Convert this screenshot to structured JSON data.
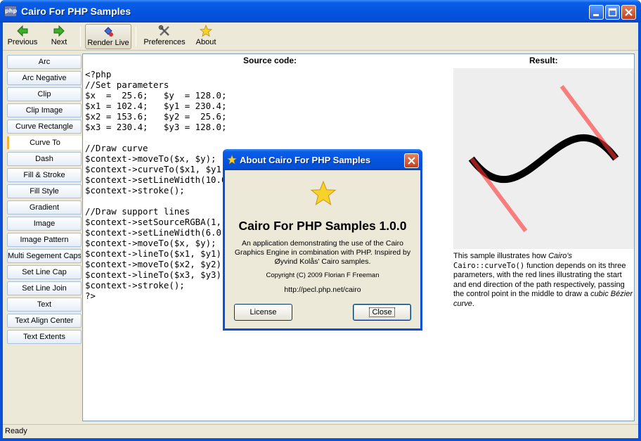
{
  "window": {
    "title": "Cairo For PHP Samples",
    "icon_text": "php",
    "controls": {
      "minimize": "minimize-icon",
      "maximize": "maximize-icon",
      "close": "close-icon"
    }
  },
  "toolbar": {
    "previous_label": "Previous",
    "next_label": "Next",
    "render_live_label": "Render Live",
    "preferences_label": "Preferences",
    "about_label": "About"
  },
  "sidebar": {
    "items": [
      {
        "label": "Arc"
      },
      {
        "label": "Arc Negative"
      },
      {
        "label": "Clip"
      },
      {
        "label": "Clip Image"
      },
      {
        "label": "Curve Rectangle"
      },
      {
        "label": "Curve To",
        "selected": true
      },
      {
        "label": "Dash"
      },
      {
        "label": "Fill & Stroke"
      },
      {
        "label": "Fill Style"
      },
      {
        "label": "Gradient"
      },
      {
        "label": "Image"
      },
      {
        "label": "Image Pattern"
      },
      {
        "label": "Multi Segement Caps"
      },
      {
        "label": "Set Line Cap"
      },
      {
        "label": "Set Line Join"
      },
      {
        "label": "Text"
      },
      {
        "label": "Text Align Center"
      },
      {
        "label": "Text Extents"
      }
    ]
  },
  "main": {
    "source_header": "Source code:",
    "result_header": "Result:",
    "code": "<?php\n//Set parameters\n$x  =  25.6;   $y  = 128.0;\n$x1 = 102.4;   $y1 = 230.4;\n$x2 = 153.6;   $y2 =  25.6;\n$x3 = 230.4;   $y3 = 128.0;\n\n//Draw curve\n$context->moveTo($x, $y);\n$context->curveTo($x1, $y1, $x2, $y2, $x3, $y3);\n$context->setLineWidth(10.0);\n$context->stroke();\n\n//Draw support lines\n$context->setSourceRGBA(1, 0.2, 0.2, 0.6);\n$context->setLineWidth(6.0);\n$context->moveTo($x, $y);\n$context->lineTo($x1, $y1);\n$context->moveTo($x2, $y2);\n$context->lineTo($x3, $y3);\n$context->stroke();\n?>",
    "description": {
      "part1": "This sample illustrates how ",
      "em1": "Cairo's",
      "mono": "Cairo::curveTo()",
      "part2": " function depends on its three parameters, with the red lines illustrating the start and end direction of the path respectively, passing the control point in the middle to draw a ",
      "em2": "cubic Bézier curve",
      "part3": "."
    }
  },
  "status": {
    "text": "Ready"
  },
  "about_dialog": {
    "title": "About Cairo For PHP Samples",
    "app_name": "Cairo For PHP Samples 1.0.0",
    "description": "An application demonstrating the use of the Cairo Graphics Engine in combination with PHP. Inspired by Øyvind Kolås' Cairo samples.",
    "copyright": "Copyright (C) 2009 Florian F Freeman",
    "url": "http://pecl.php.net/cairo",
    "license_label": "License",
    "close_label": "Close"
  },
  "colors": {
    "title_blue": "#0554e0",
    "window_bg": "#ece9d8",
    "selected_accent": "#f2b23a",
    "curve_black": "#000000",
    "support_red": "#ff3333"
  }
}
